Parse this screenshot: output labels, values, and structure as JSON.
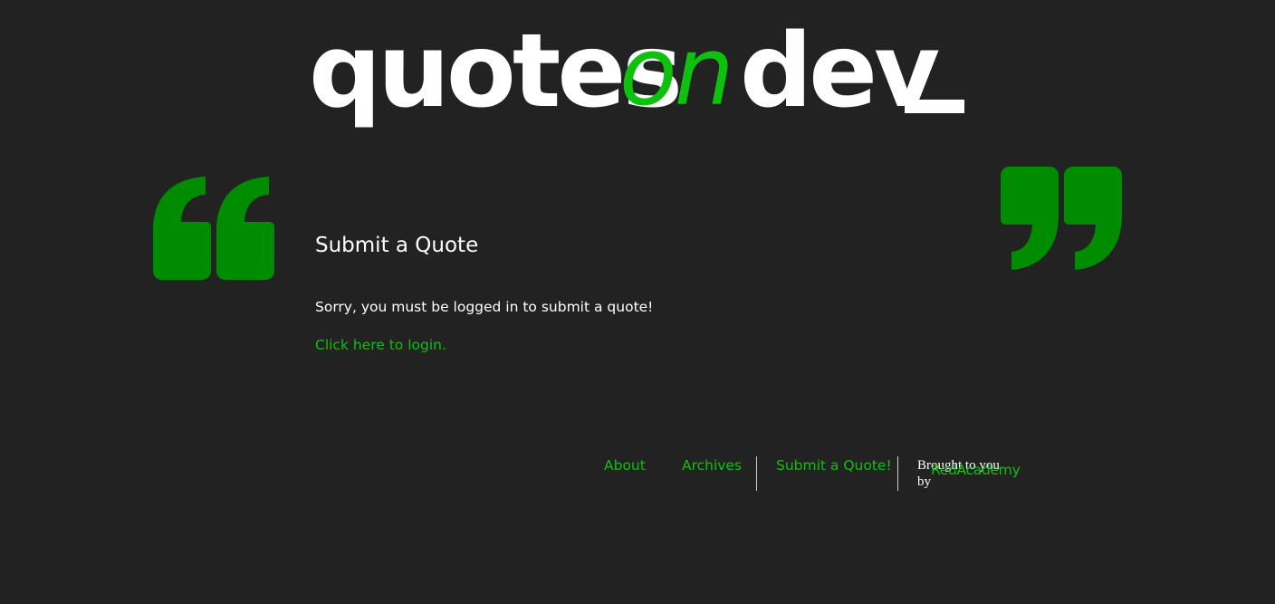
{
  "header": {
    "logo_word_1": "quotes",
    "logo_word_2": "on",
    "logo_word_3": "dev"
  },
  "main": {
    "title": "Submit a Quote",
    "message": "Sorry, you must be logged in to submit a quote!",
    "login_link": "Click here to login."
  },
  "footer": {
    "nav": {
      "about": "About",
      "archives": "Archives",
      "submit": "Submit a Quote!"
    },
    "credit_line_1": "Brought to you",
    "credit_by": "by",
    "credit_link": "RedAcademy"
  },
  "icons": {
    "open_quote": "open-quote-icon",
    "close_quote": "close-quote-icon"
  },
  "colors": {
    "background": "#222222",
    "accent_green": "#0ec10e",
    "quote_mark_green": "#008c00",
    "text": "#ffffff"
  }
}
